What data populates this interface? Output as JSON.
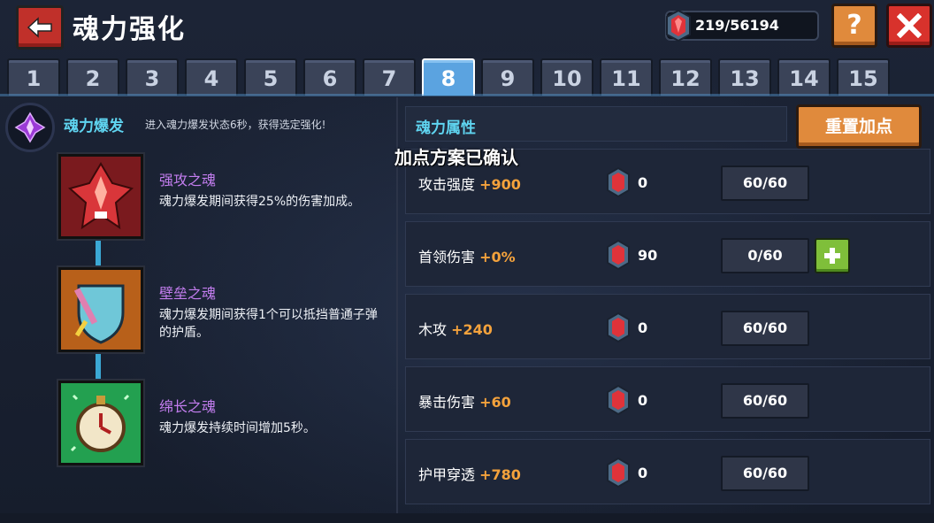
{
  "header": {
    "title": "魂力强化",
    "currency": "219/56194",
    "help_label": "?"
  },
  "tabs": [
    "1",
    "2",
    "3",
    "4",
    "5",
    "6",
    "7",
    "8",
    "9",
    "10",
    "11",
    "12",
    "13",
    "14",
    "15"
  ],
  "active_tab": "8",
  "burst": {
    "name": "魂力爆发",
    "description": "进入魂力爆发状态6秒，获得选定强化!"
  },
  "souls": [
    {
      "name": "强攻之魂",
      "description": "魂力爆发期间获得25%的伤害加成。"
    },
    {
      "name": "壁垒之魂",
      "description": "魂力爆发期间获得1个可以抵挡普通子弹的护盾。"
    },
    {
      "name": "绵长之魂",
      "description": "魂力爆发持续时间增加5秒。"
    }
  ],
  "attributes_panel": {
    "title": "魂力属性",
    "reset_label": "重置加点",
    "confirm_text": "加点方案已确认"
  },
  "attributes": [
    {
      "label": "攻击强度",
      "bonus": "+900",
      "cost": "0",
      "progress": "60/60"
    },
    {
      "label": "首领伤害",
      "bonus": "+0%",
      "cost": "90",
      "progress": "0/60"
    },
    {
      "label": "木攻",
      "bonus": "+240",
      "cost": "0",
      "progress": "60/60"
    },
    {
      "label": "暴击伤害",
      "bonus": "+60",
      "cost": "0",
      "progress": "60/60"
    },
    {
      "label": "护甲穿透",
      "bonus": "+780",
      "cost": "0",
      "progress": "60/60"
    }
  ],
  "colors": {
    "accent_orange": "#f4a23c",
    "soul_name_purple": "#c47ef0",
    "section_title_cyan": "#5fd4f0",
    "active_tab_blue": "#5ba3e0"
  }
}
